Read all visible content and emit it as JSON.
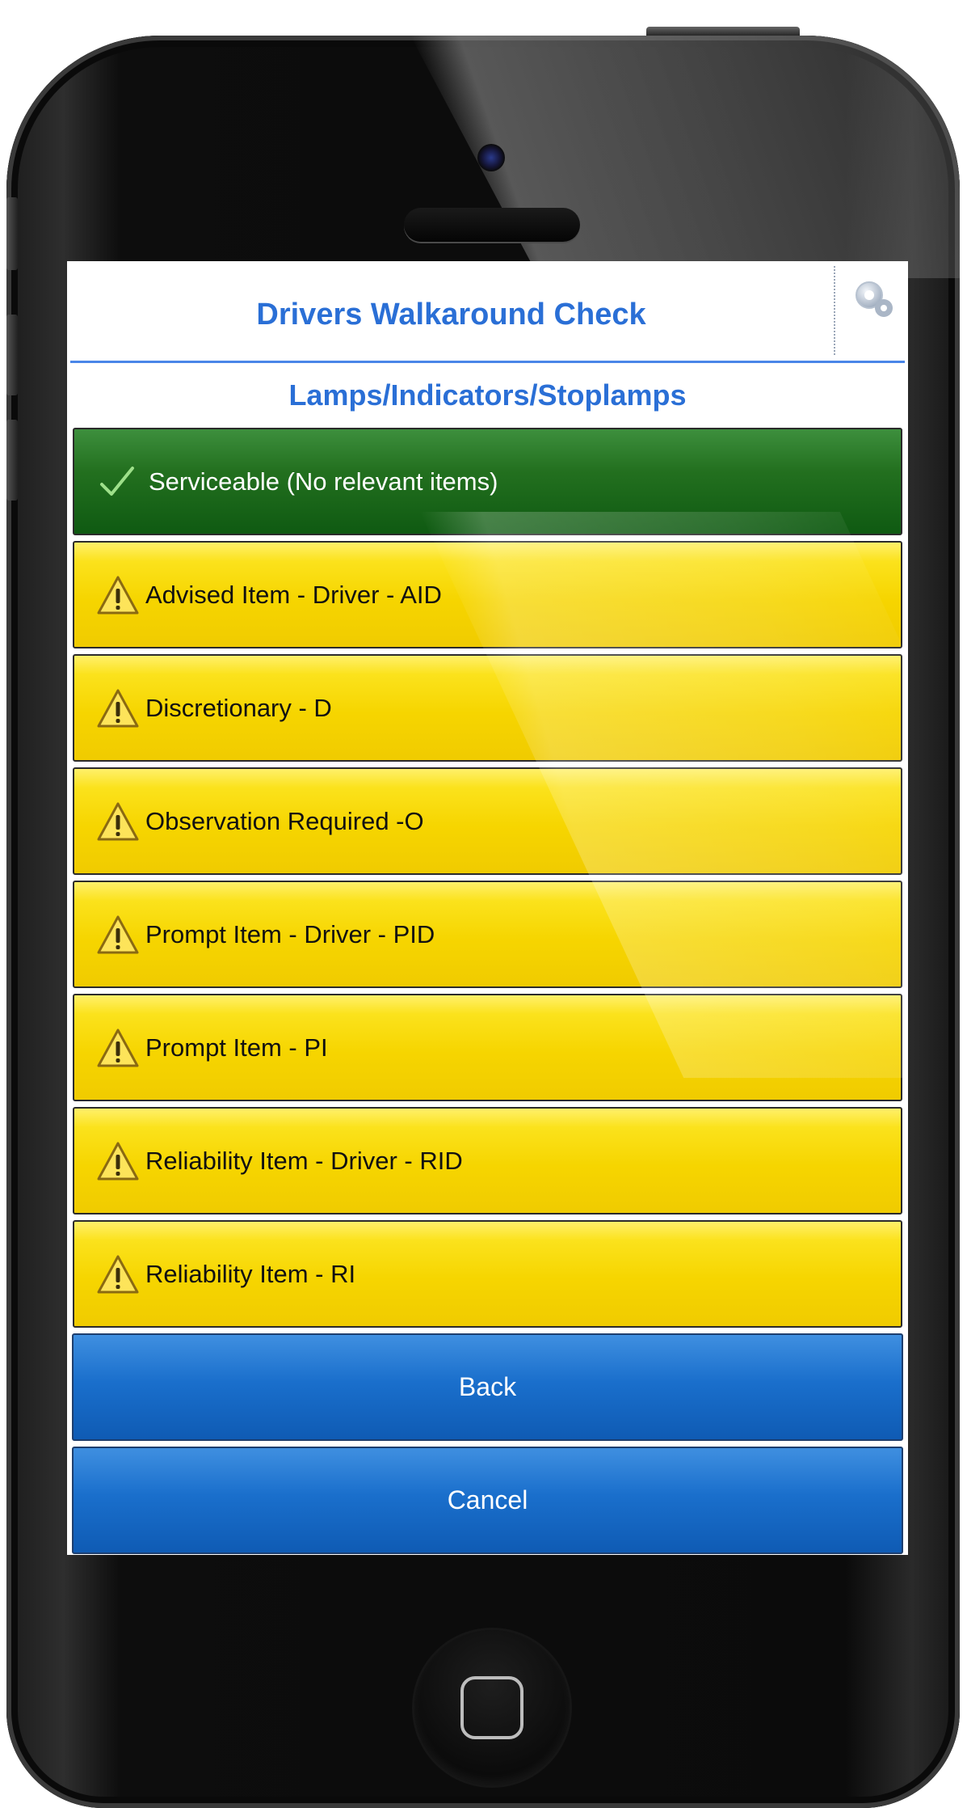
{
  "app": {
    "title": "Drivers Walkaround Check",
    "section_title": "Lamps/Indicators/Stoplamps"
  },
  "options": [
    {
      "label": "Serviceable (No relevant items)",
      "status": "serviceable",
      "icon": "checkmark-icon",
      "color": "#1f6e1f"
    },
    {
      "label": "Advised Item - Driver - AID",
      "status": "warning",
      "icon": "warning-triangle-icon",
      "color": "#f6d500"
    },
    {
      "label": "Discretionary - D",
      "status": "warning",
      "icon": "warning-triangle-icon",
      "color": "#f6d500"
    },
    {
      "label": "Observation Required -O",
      "status": "warning",
      "icon": "warning-triangle-icon",
      "color": "#f6d500"
    },
    {
      "label": "Prompt Item - Driver - PID",
      "status": "warning",
      "icon": "warning-triangle-icon",
      "color": "#f6d500"
    },
    {
      "label": "Prompt Item - PI",
      "status": "warning",
      "icon": "warning-triangle-icon",
      "color": "#f6d500"
    },
    {
      "label": "Reliability Item - Driver - RID",
      "status": "warning",
      "icon": "warning-triangle-icon",
      "color": "#f6d500"
    },
    {
      "label": "Reliability Item - RI",
      "status": "warning",
      "icon": "warning-triangle-icon",
      "color": "#f6d500"
    }
  ],
  "buttons": {
    "back_label": "Back",
    "cancel_label": "Cancel"
  },
  "colors": {
    "title_blue": "#2a6fd6",
    "button_blue": "#1a6fcc"
  }
}
